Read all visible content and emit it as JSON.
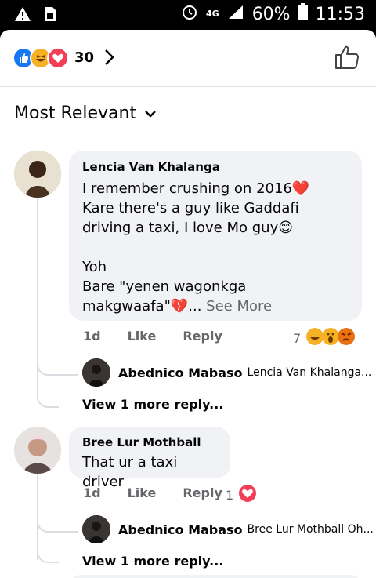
{
  "status_bar": {
    "signal_label": "4G",
    "battery": "60%",
    "time": "11:53"
  },
  "reaction_bar": {
    "count": "30"
  },
  "sort": {
    "label": "Most Relevant"
  },
  "comments": [
    {
      "author": "Lencia Van Khalanga",
      "lines": [
        "I remember crushing on 2016❤️",
        "Kare there's a guy like Gaddafi driving a taxi, I love Mo guy😊",
        "",
        "Yoh",
        "Bare \"yenen wagonkga makgwaafa\"💔..."
      ],
      "see_more": "See More",
      "time": "1d",
      "like": "Like",
      "reply": "Reply",
      "reaction_count": "7",
      "reply_preview": {
        "author": "Abednico Mabaso",
        "snippet": "Lencia Van Khalanga..."
      },
      "view_more": "View 1 more reply..."
    },
    {
      "author": "Bree Lur Mothball",
      "lines": [
        "That ur a taxi driver"
      ],
      "time": "1d",
      "like": "Like",
      "reply": "Reply",
      "reaction_count": "1",
      "reply_preview": {
        "author": "Abednico Mabaso",
        "snippet": "Bree Lur Mothball Oh..."
      },
      "view_more": "View 1 more reply..."
    }
  ],
  "colors": {
    "like_blue": "#1877f2",
    "love_red": "#f33e58",
    "haha_yellow": "#f7b125",
    "angry_orange": "#e9710f"
  }
}
